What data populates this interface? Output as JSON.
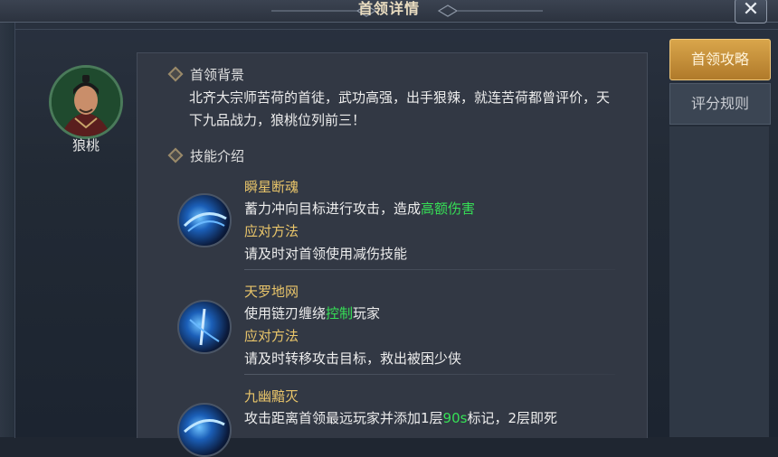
{
  "window": {
    "title": "首领详情"
  },
  "boss": {
    "name": "狼桃"
  },
  "tabs": [
    {
      "label": "首领攻略"
    },
    {
      "label": "评分规则"
    }
  ],
  "background": {
    "heading": "首领背景",
    "text": "北齐大宗师苦荷的首徒，武功高强，出手狠辣，就连苦荷都曾评价，天下九品战力，狼桃位列前三！"
  },
  "skills_section": {
    "heading": "技能介绍"
  },
  "skills": [
    {
      "name": "瞬星断魂",
      "desc_pre": "蓄力冲向目标进行攻击，造成",
      "desc_hl": "高额伤害",
      "desc_post": "",
      "counter_label": "应对方法",
      "counter": "请及时对首领使用减伤技能"
    },
    {
      "name": "天罗地网",
      "desc_pre": "使用链刃缠绕",
      "desc_hl": "控制",
      "desc_post": "玩家",
      "counter_label": "应对方法",
      "counter": "请及时转移攻击目标，救出被困少侠"
    },
    {
      "name": "九幽黯灭",
      "desc_pre": "攻击距离首领最远玩家并添加1层",
      "desc_hl": "90s",
      "desc_post": "标记，2层即死"
    }
  ],
  "colors": {
    "accent_gold": "#e9c56a",
    "highlight_green": "#36e056",
    "tab_active": "#d9a64b"
  },
  "icons": {
    "close": "close-icon",
    "section_marker": "diamond-icon"
  }
}
